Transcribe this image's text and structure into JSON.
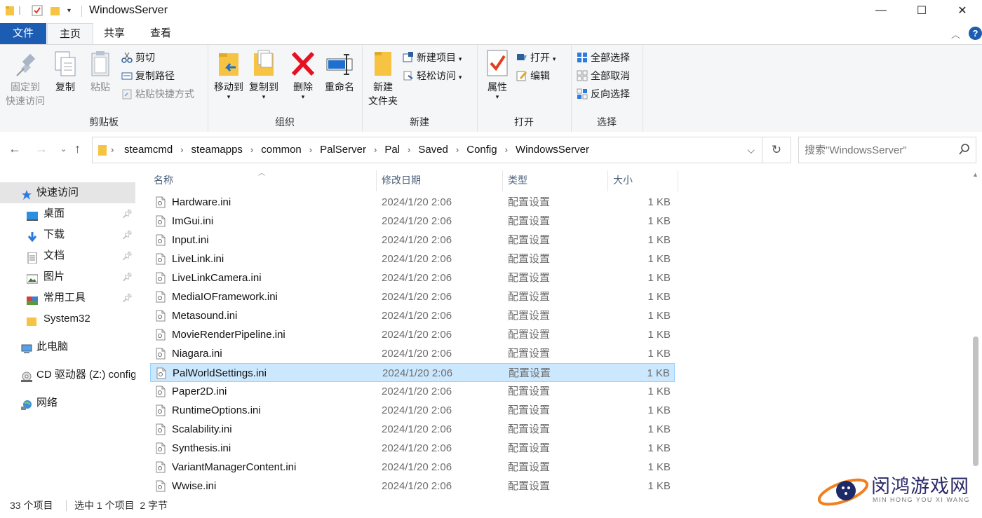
{
  "window": {
    "title": "WindowsServer",
    "minimize": "—",
    "maximize": "☐",
    "close": "✕"
  },
  "tabs": {
    "file": "文件",
    "home": "主页",
    "share": "共享",
    "view": "查看"
  },
  "ribbon": {
    "clipboard": {
      "label": "剪贴板",
      "pin_line1": "固定到",
      "pin_line2": "快速访问",
      "copy": "复制",
      "paste": "粘贴",
      "cut": "剪切",
      "copy_path": "复制路径",
      "paste_shortcut": "粘贴快捷方式"
    },
    "organize": {
      "label": "组织",
      "move_to": "移动到",
      "copy_to": "复制到",
      "delete": "删除",
      "rename": "重命名"
    },
    "new": {
      "label": "新建",
      "new_folder_line1": "新建",
      "new_folder_line2": "文件夹",
      "new_item": "新建项目",
      "easy_access": "轻松访问"
    },
    "open": {
      "label": "打开",
      "properties": "属性",
      "open": "打开",
      "edit": "编辑"
    },
    "select": {
      "label": "选择",
      "select_all": "全部选择",
      "select_none": "全部取消",
      "invert": "反向选择"
    }
  },
  "address": {
    "crumbs": [
      "steamcmd",
      "steamapps",
      "common",
      "PalServer",
      "Pal",
      "Saved",
      "Config",
      "WindowsServer"
    ]
  },
  "search": {
    "placeholder": "搜索\"WindowsServer\""
  },
  "navpane": {
    "quick_access": "快速访问",
    "items": [
      "桌面",
      "下载",
      "文档",
      "图片",
      "常用工具",
      "System32"
    ],
    "this_pc": "此电脑",
    "cd_drive": "CD 驱动器 (Z:) config",
    "network": "网络"
  },
  "columns": {
    "name": "名称",
    "modified": "修改日期",
    "type": "类型",
    "size": "大小"
  },
  "files": [
    {
      "name": "Hardware.ini",
      "modified": "2024/1/20 2:06",
      "type": "配置设置",
      "size": "1 KB"
    },
    {
      "name": "ImGui.ini",
      "modified": "2024/1/20 2:06",
      "type": "配置设置",
      "size": "1 KB"
    },
    {
      "name": "Input.ini",
      "modified": "2024/1/20 2:06",
      "type": "配置设置",
      "size": "1 KB"
    },
    {
      "name": "LiveLink.ini",
      "modified": "2024/1/20 2:06",
      "type": "配置设置",
      "size": "1 KB"
    },
    {
      "name": "LiveLinkCamera.ini",
      "modified": "2024/1/20 2:06",
      "type": "配置设置",
      "size": "1 KB"
    },
    {
      "name": "MediaIOFramework.ini",
      "modified": "2024/1/20 2:06",
      "type": "配置设置",
      "size": "1 KB"
    },
    {
      "name": "Metasound.ini",
      "modified": "2024/1/20 2:06",
      "type": "配置设置",
      "size": "1 KB"
    },
    {
      "name": "MovieRenderPipeline.ini",
      "modified": "2024/1/20 2:06",
      "type": "配置设置",
      "size": "1 KB"
    },
    {
      "name": "Niagara.ini",
      "modified": "2024/1/20 2:06",
      "type": "配置设置",
      "size": "1 KB"
    },
    {
      "name": "PalWorldSettings.ini",
      "modified": "2024/1/20 2:06",
      "type": "配置设置",
      "size": "1 KB",
      "selected": true
    },
    {
      "name": "Paper2D.ini",
      "modified": "2024/1/20 2:06",
      "type": "配置设置",
      "size": "1 KB"
    },
    {
      "name": "RuntimeOptions.ini",
      "modified": "2024/1/20 2:06",
      "type": "配置设置",
      "size": "1 KB"
    },
    {
      "name": "Scalability.ini",
      "modified": "2024/1/20 2:06",
      "type": "配置设置",
      "size": "1 KB"
    },
    {
      "name": "Synthesis.ini",
      "modified": "2024/1/20 2:06",
      "type": "配置设置",
      "size": "1 KB"
    },
    {
      "name": "VariantManagerContent.ini",
      "modified": "2024/1/20 2:06",
      "type": "配置设置",
      "size": "1 KB"
    },
    {
      "name": "Wwise.ini",
      "modified": "2024/1/20 2:06",
      "type": "配置设置",
      "size": "1 KB"
    }
  ],
  "status": {
    "count": "33 个项目",
    "selection": "选中 1 个项目  2 字节"
  },
  "watermark": {
    "title": "闵鸿游戏网",
    "subtitle": "MIN HONG YOU XI WANG"
  },
  "colors": {
    "accent": "#1c5cb3",
    "selection": "#cce8ff",
    "folder": "#f6c342",
    "delete_red": "#e81123"
  }
}
